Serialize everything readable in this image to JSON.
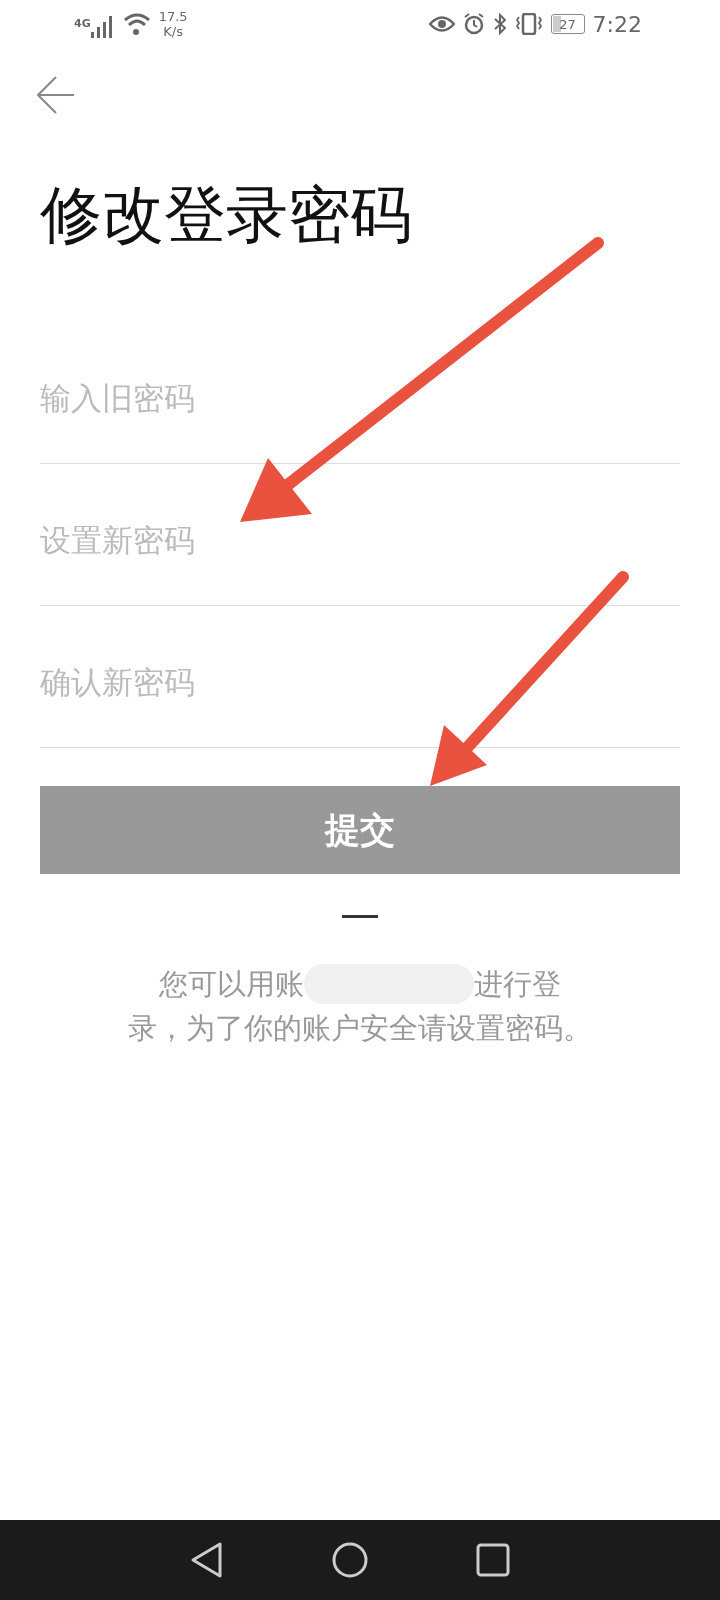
{
  "status_bar": {
    "network": "4G",
    "speed_value": "17.5",
    "speed_unit": "K/s",
    "battery": "27",
    "time": "7:22"
  },
  "title": "修改登录密码",
  "fields": [
    {
      "placeholder": "输入旧密码"
    },
    {
      "placeholder": "设置新密码"
    },
    {
      "placeholder": "确认新密码"
    }
  ],
  "submit_button": "提交",
  "info": {
    "line_1_start": "您可以用账",
    "line_1_end": "进行登",
    "line_2": "录，为了你的账户安全请设置密码。"
  }
}
